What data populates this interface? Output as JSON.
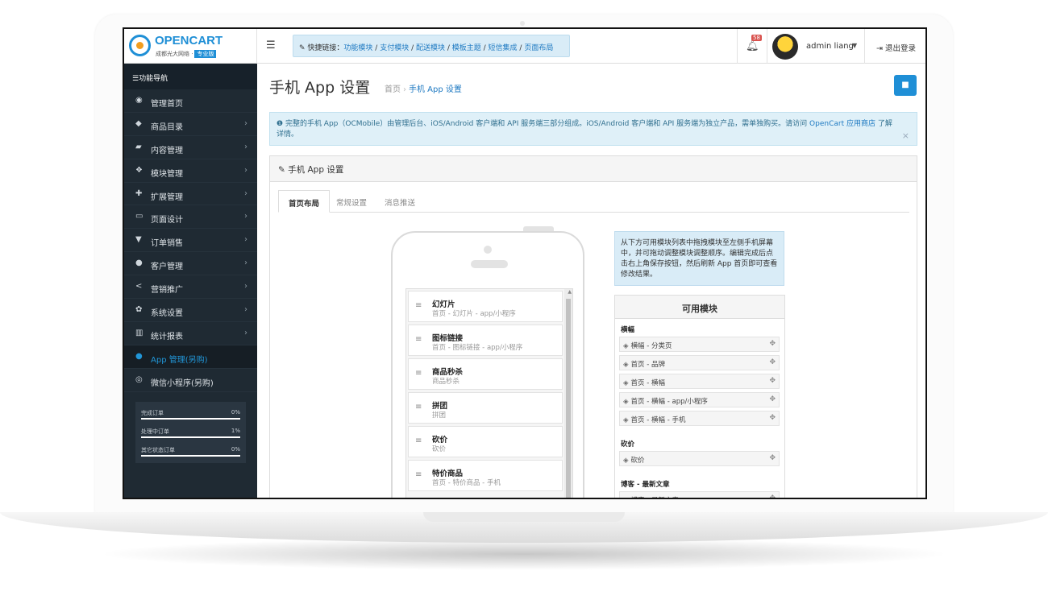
{
  "brand": {
    "name": "OPENCART",
    "sub": "成都光大网络 ·",
    "edition": "专业版"
  },
  "quicklinks": {
    "prefix": "快捷链接：",
    "links": [
      "功能模块",
      "支付模块",
      "配送模块",
      "模板主题",
      "短信集成",
      "页面布局"
    ],
    "sep": " / "
  },
  "notifications": {
    "count": "58"
  },
  "user": {
    "name": "admin liang"
  },
  "logout_label": "退出登录",
  "sidebar": {
    "title": "功能导航",
    "items": [
      {
        "label": "管理首页",
        "icon": "dashboard-icon",
        "glyph": "◉",
        "arrow": ""
      },
      {
        "label": "商品目录",
        "icon": "tag-icon",
        "glyph": "◆",
        "arrow": "›"
      },
      {
        "label": "内容管理",
        "icon": "book-icon",
        "glyph": "▰",
        "arrow": "›"
      },
      {
        "label": "模块管理",
        "icon": "cube-icon",
        "glyph": "❖",
        "arrow": "›"
      },
      {
        "label": "扩展管理",
        "icon": "puzzle-icon",
        "glyph": "✚",
        "arrow": "›"
      },
      {
        "label": "页面设计",
        "icon": "desktop-icon",
        "glyph": "▭",
        "arrow": "›"
      },
      {
        "label": "订单销售",
        "icon": "cart-icon",
        "glyph": "▼",
        "arrow": "›"
      },
      {
        "label": "客户管理",
        "icon": "user-icon",
        "glyph": "●",
        "arrow": "›"
      },
      {
        "label": "营销推广",
        "icon": "share-icon",
        "glyph": "<",
        "arrow": "›"
      },
      {
        "label": "系统设置",
        "icon": "gear-icon",
        "glyph": "✿",
        "arrow": "›"
      },
      {
        "label": "统计报表",
        "icon": "bar-chart-icon",
        "glyph": "▥",
        "arrow": "›"
      },
      {
        "label": "App 管理(另购)",
        "icon": "apple-icon",
        "glyph": "●",
        "arrow": ""
      },
      {
        "label": "微信小程序(另购)",
        "icon": "wechat-icon",
        "glyph": "◎",
        "arrow": ""
      }
    ],
    "stats": [
      {
        "label": "完成订单",
        "value": "0%"
      },
      {
        "label": "处理中订单",
        "value": "1%"
      },
      {
        "label": "其它状态订单",
        "value": "0%"
      }
    ]
  },
  "page": {
    "title": "手机 App 设置",
    "breadcrumb": [
      "首页",
      "手机 App 设置"
    ],
    "alert": {
      "text": "完整的手机 App（OCMobile）由管理后台、iOS/Android 客户端和 API 服务端三部分组成。iOS/Android 客户端和 API 服务端为独立产品，需单独购买。请访问 ",
      "link": "OpenCart 应用商店",
      "tail": " 了解详情。"
    },
    "panel_title": "手机 App 设置",
    "tabs": [
      "首页布局",
      "常规设置",
      "消息推送"
    ]
  },
  "layout_modules": [
    {
      "title": "幻灯片",
      "sub": "首页 - 幻灯片 - app/小程序"
    },
    {
      "title": "图标链接",
      "sub": "首页 - 图标链接 - app/小程序"
    },
    {
      "title": "商品秒杀",
      "sub": "商品秒杀"
    },
    {
      "title": "拼团",
      "sub": "拼团"
    },
    {
      "title": "砍价",
      "sub": "砍价"
    },
    {
      "title": "特价商品",
      "sub": "首页 - 特价商品 - 手机"
    }
  ],
  "hint": "从下方可用模块列表中拖拽模块至左侧手机屏幕中，并可拖动调整模块调整顺序。编辑完成后点击右上角保存按钮，然后刷新 App 首页即可查看修改结果。",
  "available": {
    "title": "可用模块",
    "groups": [
      {
        "name": "横幅",
        "items": [
          "横幅 - 分类页",
          "首页 - 品牌",
          "首页 - 横幅",
          "首页 - 横幅 - app/小程序",
          "首页 - 横幅 - 手机"
        ]
      },
      {
        "name": "砍价",
        "items": [
          "砍价"
        ]
      },
      {
        "name": "博客 - 最新文章",
        "items": [
          "博客 - 最新文章"
        ]
      }
    ]
  },
  "colors": {
    "accent": "#1f8fd6",
    "sidebar_bg": "#1f2a33",
    "alert_bg": "#dff0f8",
    "badge": "#d9534f"
  }
}
